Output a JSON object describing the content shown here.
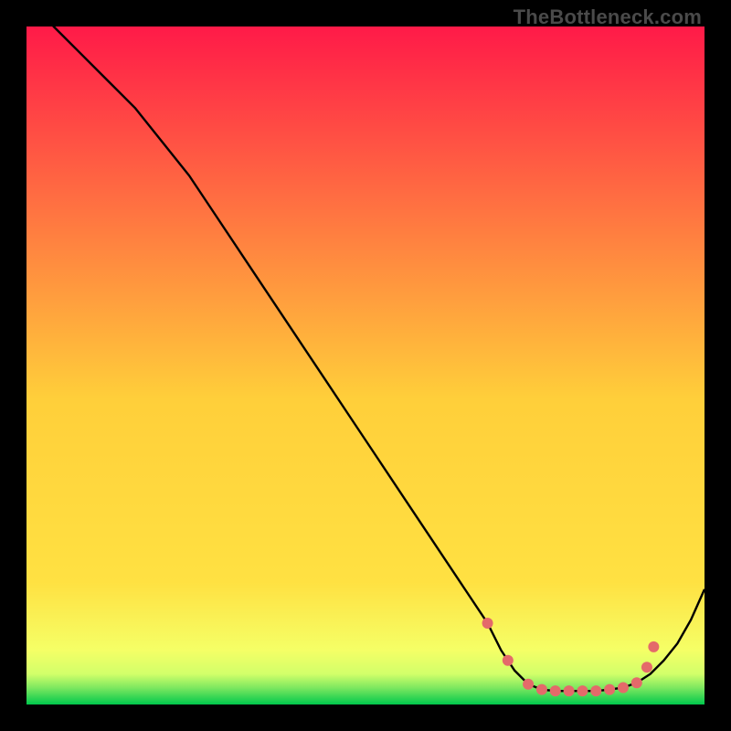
{
  "watermark": "TheBottleneck.com",
  "chart_data": {
    "type": "line",
    "title": "",
    "xlabel": "",
    "ylabel": "",
    "xlim": [
      0,
      100
    ],
    "ylim": [
      0,
      100
    ],
    "grid": false,
    "legend": false,
    "background_gradient": {
      "from": "#ff1a48",
      "mid": "#ffe142",
      "to": "#00c84c",
      "green_band_start_y": 5
    },
    "series": [
      {
        "name": "bottleneck-curve",
        "color": "#000000",
        "x": [
          0,
          4,
          8,
          12,
          16,
          20,
          24,
          28,
          32,
          36,
          40,
          44,
          48,
          52,
          56,
          60,
          64,
          68,
          70,
          72,
          74,
          76,
          78,
          80,
          82,
          84,
          86,
          88,
          90,
          92,
          94,
          96,
          98,
          100
        ],
        "y": [
          105,
          100,
          96,
          92,
          88,
          83,
          78,
          72,
          66,
          60,
          54,
          48,
          42,
          36,
          30,
          24,
          18,
          12,
          8,
          5,
          3,
          2.2,
          2.0,
          2.0,
          2.0,
          2.0,
          2.2,
          2.5,
          3.2,
          4.5,
          6.5,
          9,
          12.5,
          17
        ]
      }
    ],
    "markers": {
      "name": "highlighted-points",
      "color": "#e46a6a",
      "radius": 6,
      "points": [
        {
          "x": 68,
          "y": 12
        },
        {
          "x": 71,
          "y": 6.5
        },
        {
          "x": 74,
          "y": 3.0
        },
        {
          "x": 76,
          "y": 2.2
        },
        {
          "x": 78,
          "y": 2.0
        },
        {
          "x": 80,
          "y": 2.0
        },
        {
          "x": 82,
          "y": 2.0
        },
        {
          "x": 84,
          "y": 2.0
        },
        {
          "x": 86,
          "y": 2.2
        },
        {
          "x": 88,
          "y": 2.5
        },
        {
          "x": 90,
          "y": 3.2
        },
        {
          "x": 91.5,
          "y": 5.5
        },
        {
          "x": 92.5,
          "y": 8.5
        }
      ]
    }
  }
}
